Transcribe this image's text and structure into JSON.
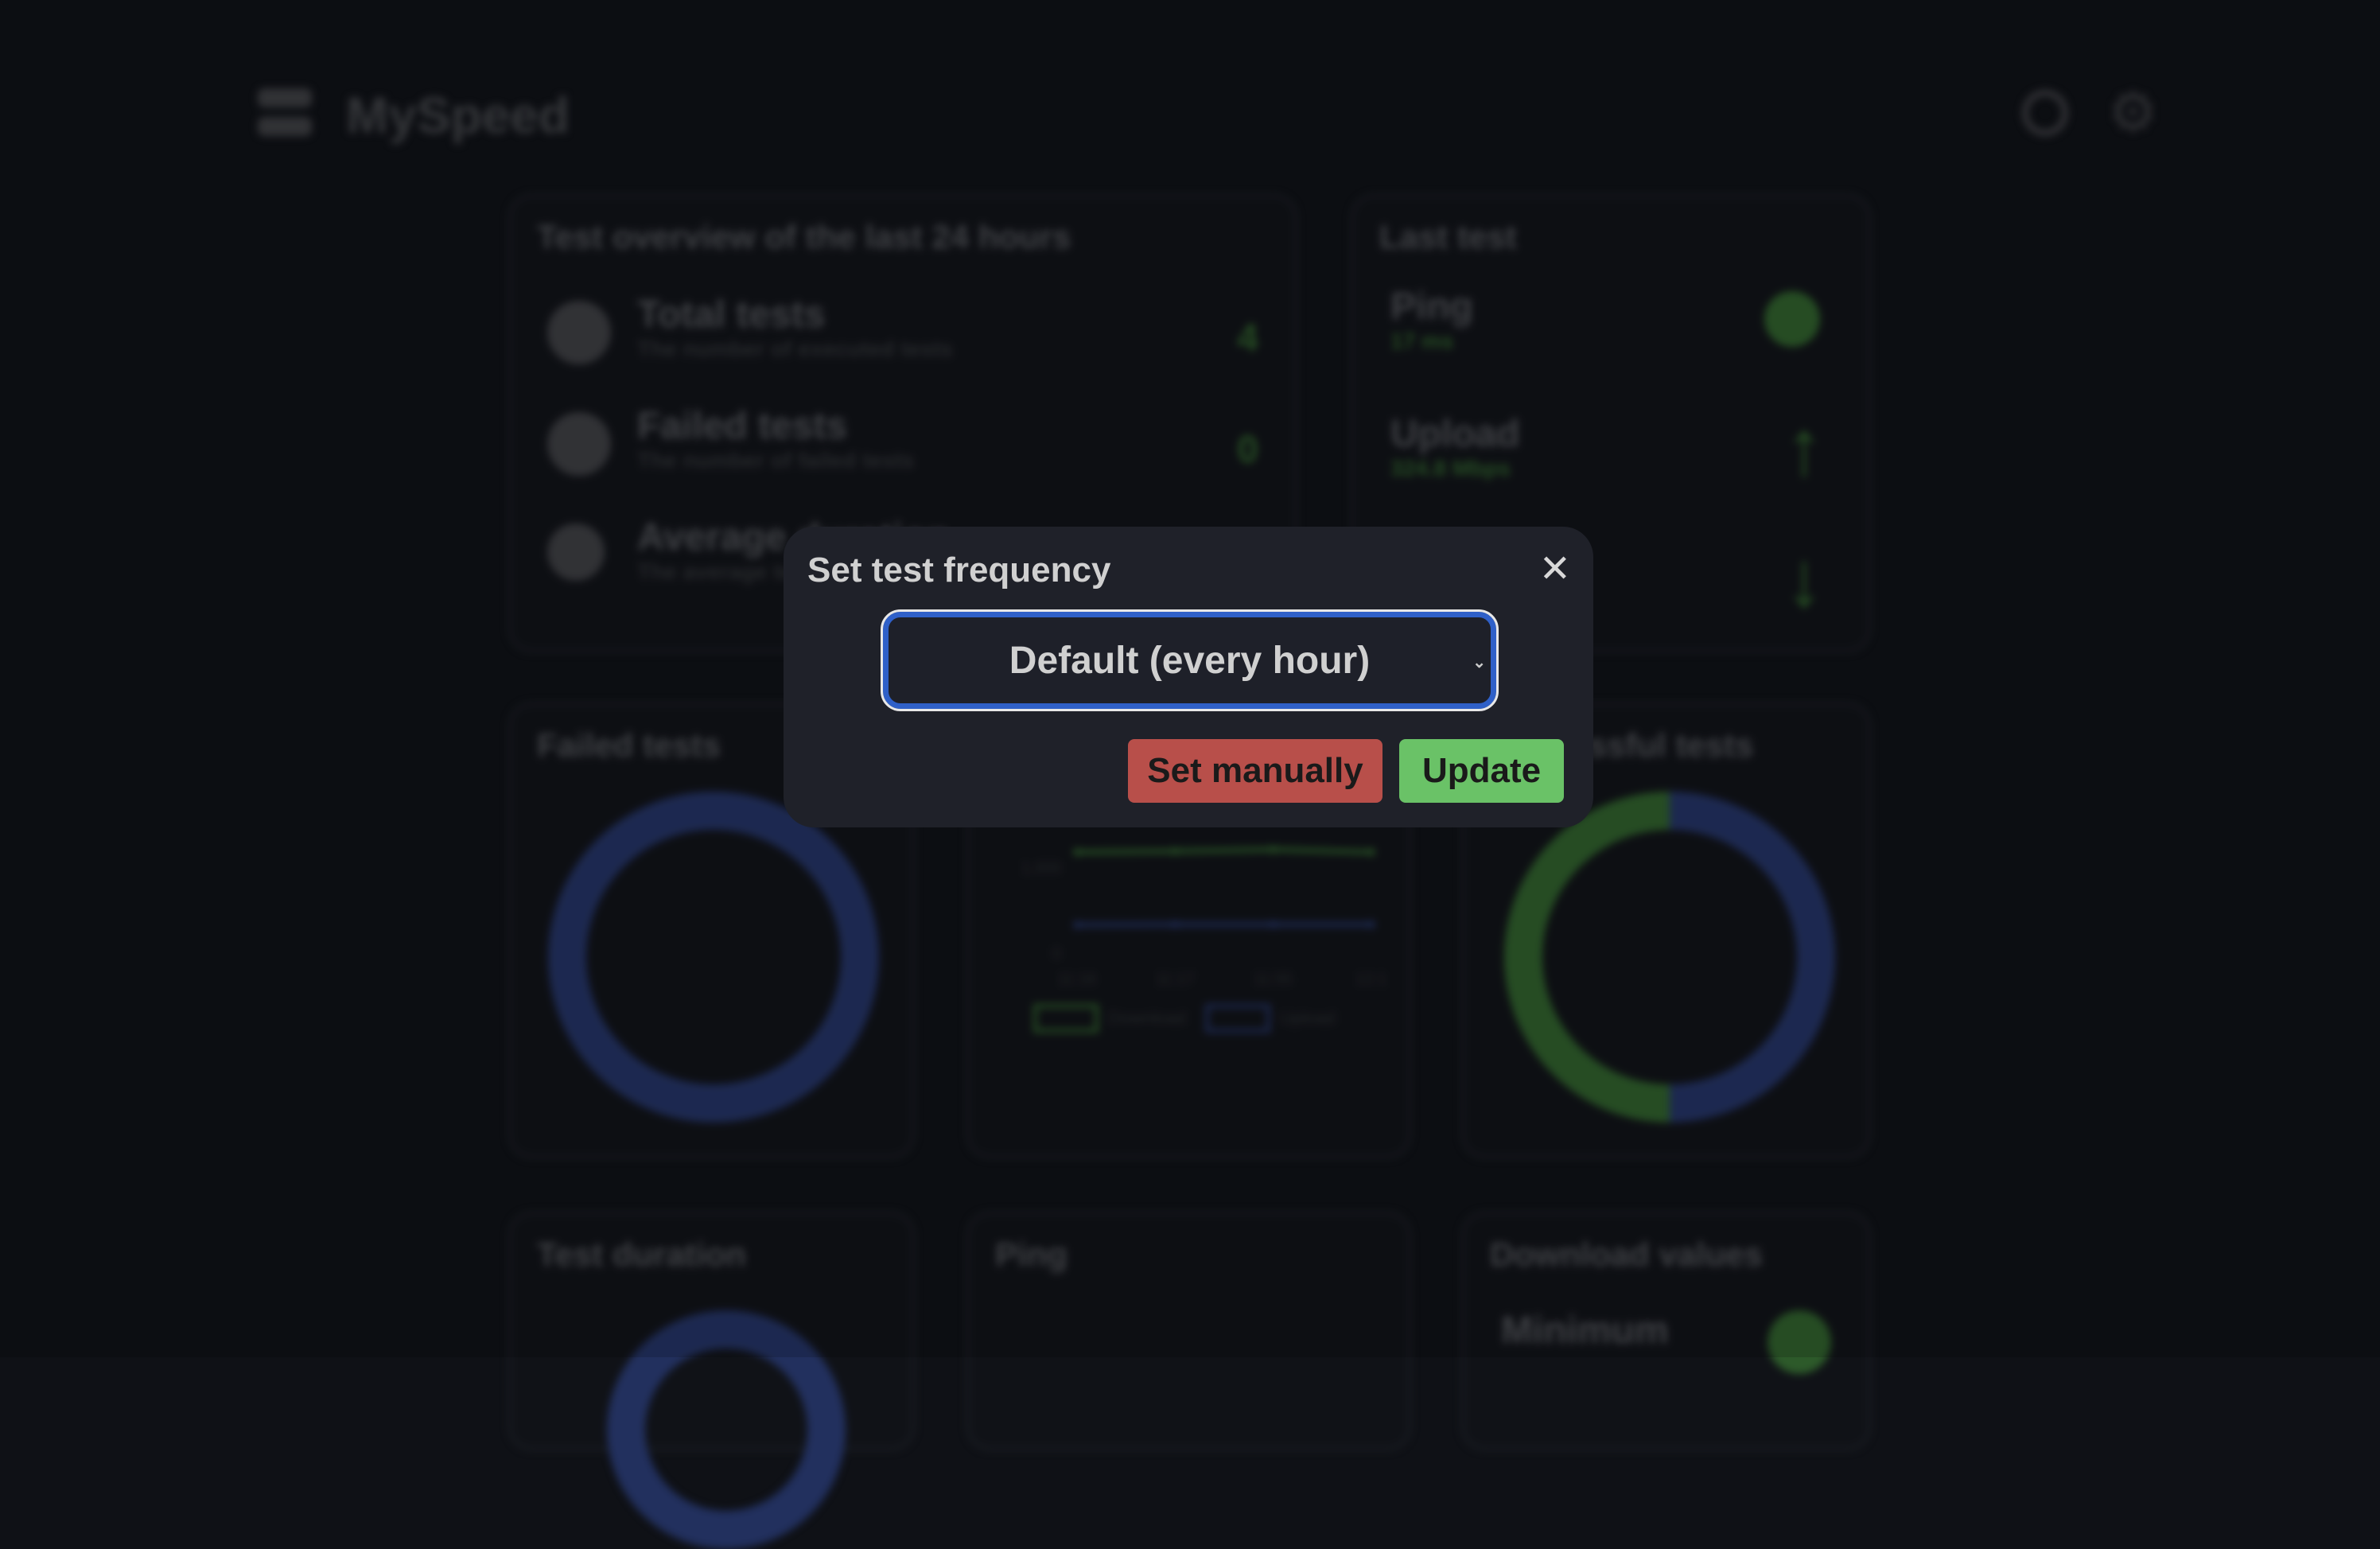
{
  "header": {
    "title": "MySpeed"
  },
  "overview": {
    "title": "Test overview of the last 24 hours",
    "rows": [
      {
        "title": "Total tests",
        "subtitle": "The number of executed tests",
        "value": "4"
      },
      {
        "title": "Failed tests",
        "subtitle": "The number of failed tests",
        "value": "0"
      },
      {
        "title": "Average duration",
        "subtitle": "The average test duration"
      }
    ]
  },
  "last_test": {
    "title": "Last test",
    "ping": {
      "label": "Ping",
      "value": "17 ms"
    },
    "upload": {
      "label": "Upload",
      "value": "324.8 Mbps"
    }
  },
  "failed_card": {
    "title": "Failed tests"
  },
  "successful_card": {
    "title": "Successful tests"
  },
  "speed_chart": {
    "chart_data": {
      "type": "line",
      "x": [
        "11:16",
        "11:17",
        "11:55",
        "12:1"
      ],
      "yticks": [
        "1,000",
        "0"
      ],
      "series": [
        {
          "name": "Download",
          "color": "#2d5a2a",
          "values": [
            1170,
            1180,
            1200,
            1170
          ]
        },
        {
          "name": "Upload",
          "color": "#22305e",
          "values": [
            320,
            325,
            325,
            325
          ]
        }
      ]
    }
  },
  "bottom": {
    "duration": "Test duration",
    "ping": "Ping",
    "download_values": "Download values",
    "minimum": "Minimum"
  },
  "modal": {
    "title": "Set test frequency",
    "select_value": "Default (every hour)",
    "set_manually": "Set manually",
    "update": "Update"
  },
  "colors": {
    "accent_green": "#6ac267",
    "danger": "#b84f4a",
    "focus": "#2f60c8"
  }
}
